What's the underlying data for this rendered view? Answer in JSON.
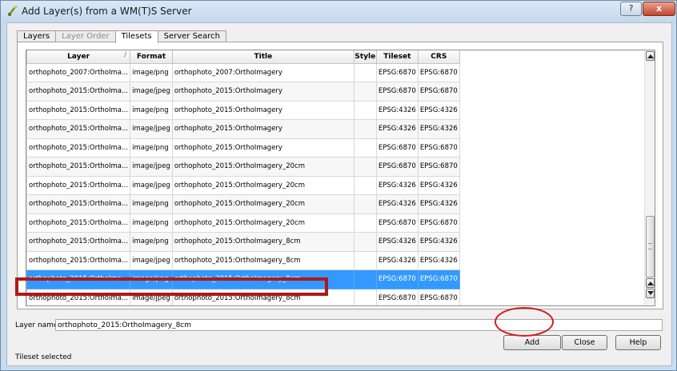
{
  "window": {
    "title": "Add Layer(s) from a WM(T)S Server",
    "help_button": "?",
    "close_button": "x"
  },
  "tabs": [
    {
      "label": "Layers",
      "state": "normal"
    },
    {
      "label": "Layer Order",
      "state": "disabled"
    },
    {
      "label": "Tilesets",
      "state": "active"
    },
    {
      "label": "Server Search",
      "state": "normal"
    }
  ],
  "table": {
    "columns": [
      "Layer",
      "Format",
      "Title",
      "Style",
      "Tileset",
      "CRS"
    ],
    "rows": [
      {
        "layer": "orthophoto_2007:OrthoIma...",
        "format": "image/png",
        "title": "orthophoto_2007:OrthoImagery",
        "style": "",
        "tileset": "EPSG:6870",
        "crs": "EPSG:6870"
      },
      {
        "layer": "orthophoto_2015:OrthoIma...",
        "format": "image/jpeg",
        "title": "orthophoto_2015:OrthoImagery",
        "style": "",
        "tileset": "EPSG:6870",
        "crs": "EPSG:6870"
      },
      {
        "layer": "orthophoto_2015:OrthoIma...",
        "format": "image/png",
        "title": "orthophoto_2015:OrthoImagery",
        "style": "",
        "tileset": "EPSG:4326",
        "crs": "EPSG:4326"
      },
      {
        "layer": "orthophoto_2015:OrthoIma...",
        "format": "image/jpeg",
        "title": "orthophoto_2015:OrthoImagery",
        "style": "",
        "tileset": "EPSG:4326",
        "crs": "EPSG:4326"
      },
      {
        "layer": "orthophoto_2015:OrthoIma...",
        "format": "image/png",
        "title": "orthophoto_2015:OrthoImagery",
        "style": "",
        "tileset": "EPSG:6870",
        "crs": "EPSG:6870"
      },
      {
        "layer": "orthophoto_2015:OrthoIma...",
        "format": "image/jpeg",
        "title": "orthophoto_2015:OrthoImagery_20cm",
        "style": "",
        "tileset": "EPSG:6870",
        "crs": "EPSG:6870"
      },
      {
        "layer": "orthophoto_2015:OrthoIma...",
        "format": "image/jpeg",
        "title": "orthophoto_2015:OrthoImagery_20cm",
        "style": "",
        "tileset": "EPSG:4326",
        "crs": "EPSG:4326"
      },
      {
        "layer": "orthophoto_2015:OrthoIma...",
        "format": "image/png",
        "title": "orthophoto_2015:OrthoImagery_20cm",
        "style": "",
        "tileset": "EPSG:4326",
        "crs": "EPSG:4326"
      },
      {
        "layer": "orthophoto_2015:OrthoIma...",
        "format": "image/png",
        "title": "orthophoto_2015:OrthoImagery_20cm",
        "style": "",
        "tileset": "EPSG:6870",
        "crs": "EPSG:6870"
      },
      {
        "layer": "orthophoto_2015:OrthoIma...",
        "format": "image/png",
        "title": "orthophoto_2015:OrthoImagery_8cm",
        "style": "",
        "tileset": "EPSG:4326",
        "crs": "EPSG:4326"
      },
      {
        "layer": "orthophoto_2015:OrthoIma...",
        "format": "image/jpeg",
        "title": "orthophoto_2015:OrthoImagery_8cm",
        "style": "",
        "tileset": "EPSG:4326",
        "crs": "EPSG:4326"
      },
      {
        "layer": "orthophoto_2015:OrthoIma...",
        "format": "image/png",
        "title": "orthophoto_2015:OrthoImagery_8cm",
        "style": "",
        "tileset": "EPSG:6870",
        "crs": "EPSG:6870",
        "selected": true
      },
      {
        "layer": "orthophoto_2015:OrthoIma...",
        "format": "image/jpeg",
        "title": "orthophoto_2015:OrthoImagery_8cm",
        "style": "",
        "tileset": "EPSG:6870",
        "crs": "EPSG:6870"
      }
    ]
  },
  "layer_name": {
    "label": "Layer name",
    "value": "orthophoto_2015:OrthoImagery_8cm"
  },
  "buttons": {
    "add": "Add",
    "close": "Close",
    "help": "Help"
  },
  "status": "Tileset selected",
  "colors": {
    "selection": "#3399ff",
    "annotation_red": "#b01818"
  },
  "icons": [
    "qgis-wms-icon",
    "help-icon",
    "close-icon",
    "scroll-up-arrow-icon",
    "scroll-down-arrow-icon"
  ]
}
